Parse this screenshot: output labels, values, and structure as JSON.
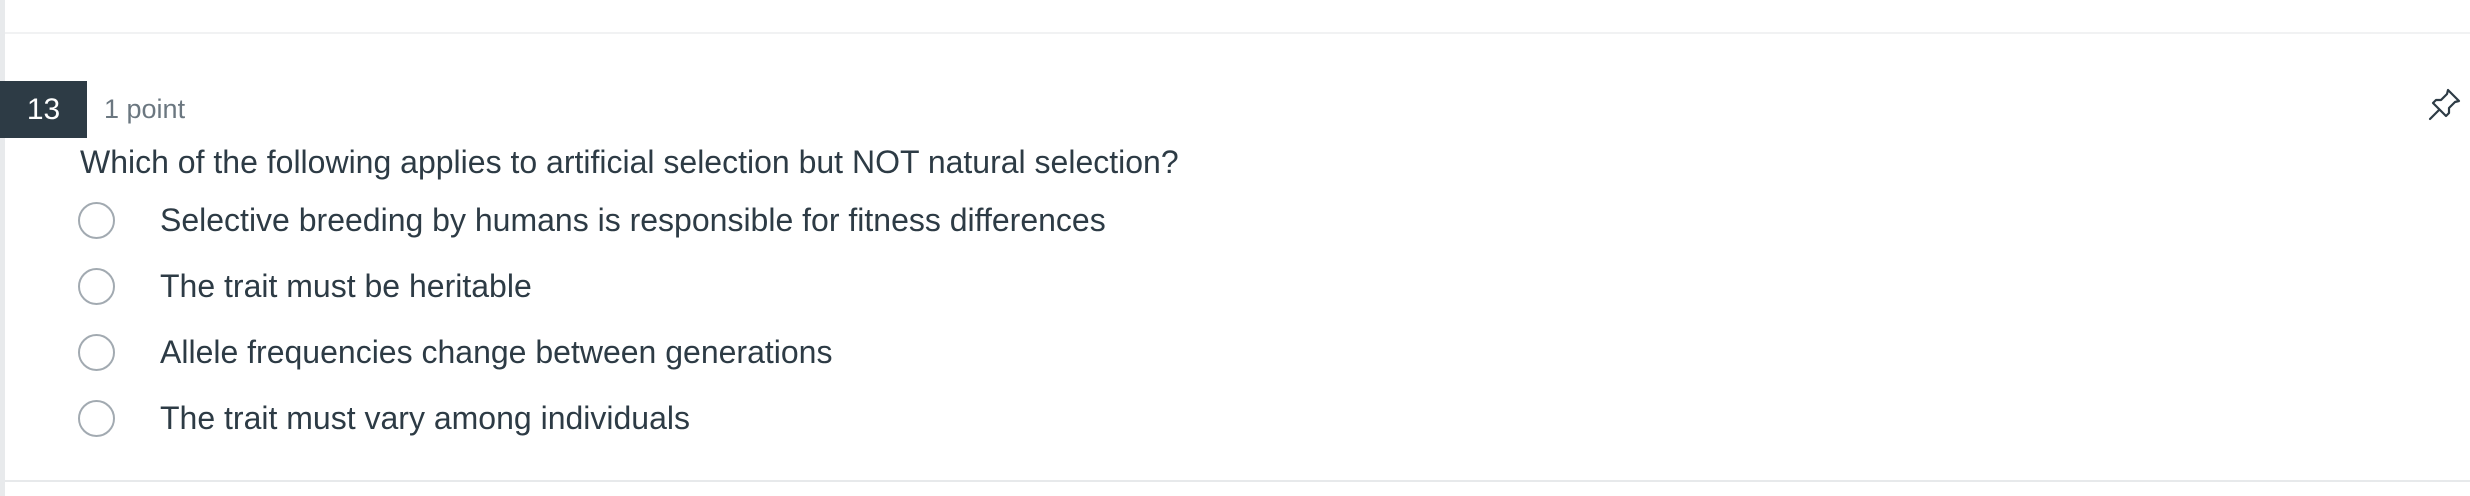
{
  "question": {
    "number": "13",
    "points": "1 point",
    "text": "Which of the following applies to artificial selection but NOT natural selection?",
    "options": [
      {
        "label": "Selective breeding by humans is responsible for fitness differences",
        "selected": false
      },
      {
        "label": "The trait must be heritable",
        "selected": false
      },
      {
        "label": "Allele frequencies change between generations",
        "selected": false
      },
      {
        "label": "The trait must vary among individuals",
        "selected": false
      }
    ]
  },
  "icons": {
    "pin": "pin-icon",
    "radio": "radio-unchecked-icon"
  },
  "colors": {
    "number_badge_bg": "#2d3b45",
    "text": "#2d3b45",
    "muted_text": "#6b7780",
    "radio_border": "#a2aab1"
  }
}
